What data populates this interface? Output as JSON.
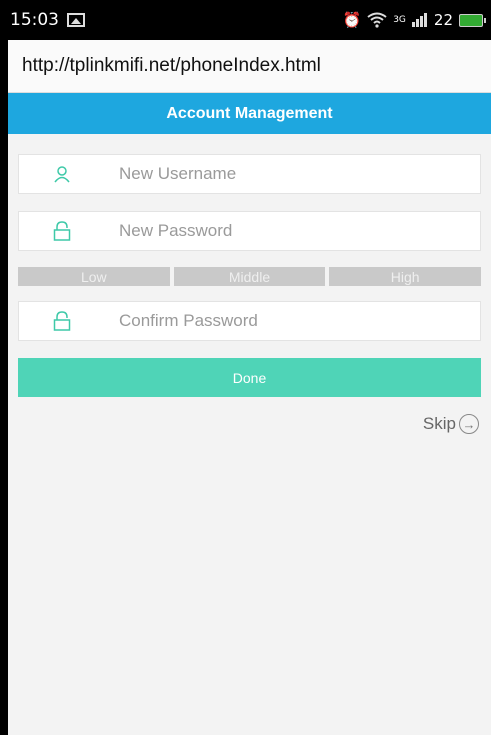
{
  "status": {
    "time": "15:03",
    "network": "3G",
    "battery": "22"
  },
  "browser": {
    "url": "http://tplinkmifi.net/phoneIndex.html"
  },
  "page": {
    "title": "Account Management"
  },
  "form": {
    "username_placeholder": "New Username",
    "password_placeholder": "New Password",
    "confirm_placeholder": "Confirm Password",
    "strength": [
      "Low",
      "Middle",
      "High"
    ],
    "done_label": "Done",
    "skip_label": "Skip"
  },
  "colors": {
    "header": "#1ea7df",
    "accent": "#4fd4b7",
    "icon": "#3ec9a8"
  }
}
